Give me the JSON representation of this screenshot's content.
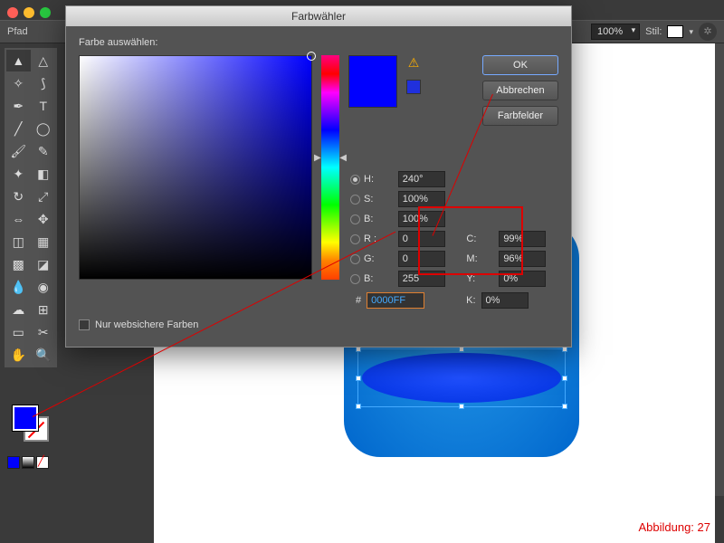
{
  "app": {
    "pathLabel": "Pfad",
    "zoom": "100%",
    "styleLabel": "Stil:"
  },
  "dialog": {
    "title": "Farbwähler",
    "selectLabel": "Farbe auswählen:",
    "ok": "OK",
    "cancel": "Abbrechen",
    "swatches": "Farbfelder",
    "websafe": "Nur websichere Farben",
    "hsv": {
      "hL": "H:",
      "h": "240°",
      "sL": "S:",
      "s": "100%",
      "bL": "B:",
      "b": "100%"
    },
    "rgb": {
      "rL": "R :",
      "r": "0",
      "gL": "G:",
      "g": "0",
      "bL": "B:",
      "b": "255"
    },
    "cmyk": {
      "cL": "C:",
      "c": "99%",
      "mL": "M:",
      "m": "96%",
      "yL": "Y:",
      "y": "0%",
      "kL": "K:",
      "k": "0%"
    },
    "hexLabel": "#",
    "hex": "0000FF"
  },
  "caption": "Abbildung: 27"
}
